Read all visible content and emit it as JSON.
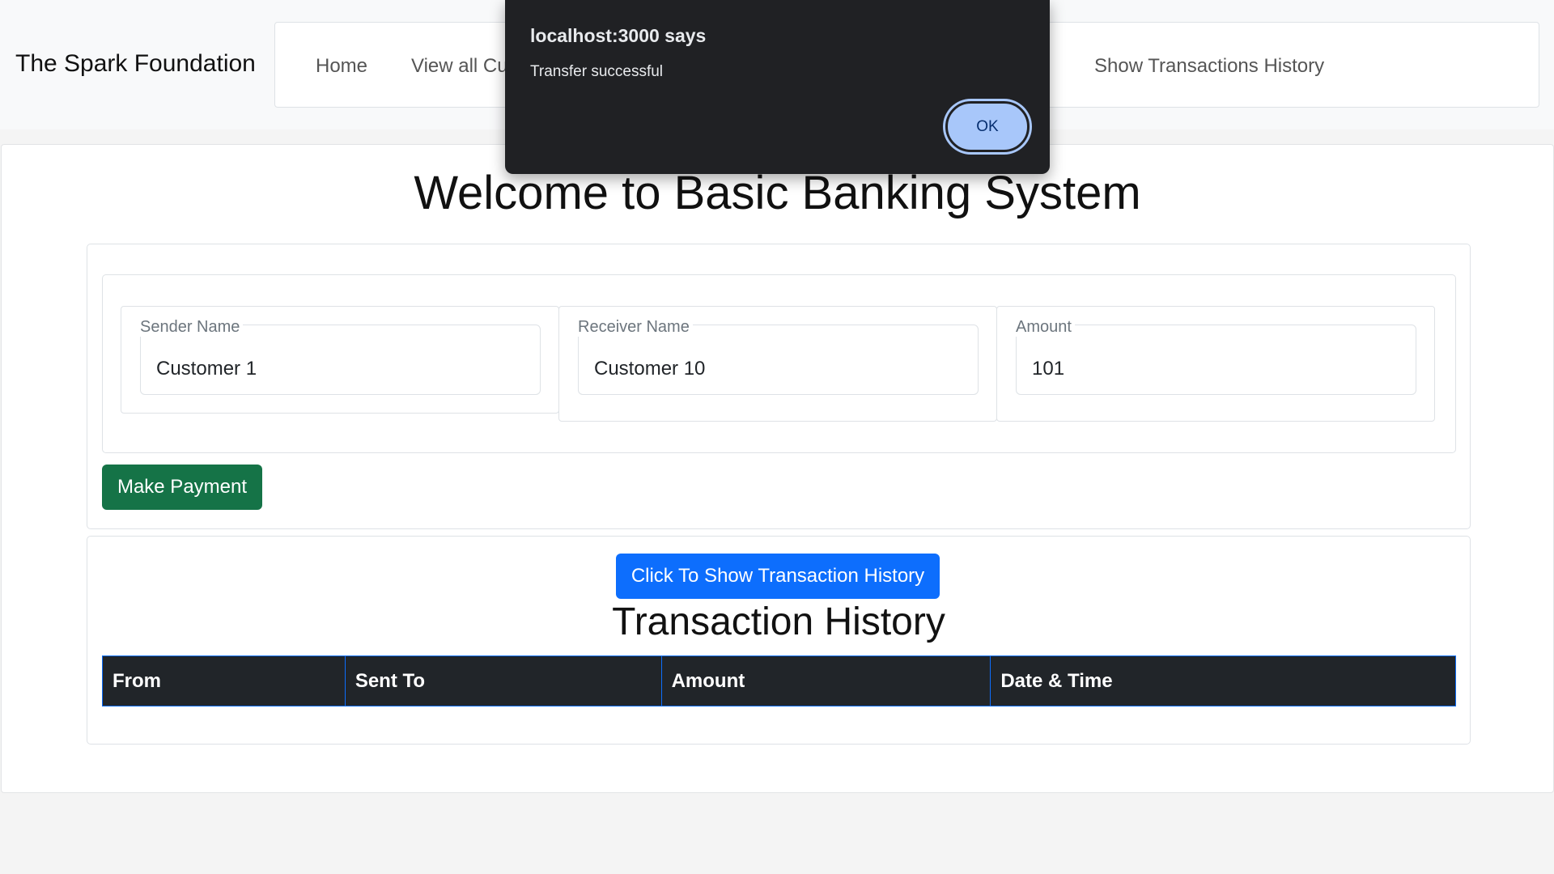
{
  "navbar": {
    "brand": "The Spark Foundation",
    "links": [
      {
        "label": "Home"
      },
      {
        "label": "View all Cu"
      },
      {
        "label": "Show Transactions History"
      }
    ]
  },
  "main": {
    "title": "Welcome to Basic Banking System"
  },
  "form": {
    "sender": {
      "label": "Sender Name",
      "value": "Customer 1"
    },
    "receiver": {
      "label": "Receiver Name",
      "value": "Customer 10"
    },
    "amount": {
      "label": "Amount",
      "value": "101"
    },
    "submit_label": "Make Payment"
  },
  "history": {
    "button_label": "Click To Show Transaction History",
    "title": "Transaction History",
    "columns": [
      "From",
      "Sent To",
      "Amount",
      "Date & Time"
    ],
    "rows": []
  },
  "dialog": {
    "origin": "localhost:3000 says",
    "message": "Transfer successful",
    "ok_label": "OK"
  },
  "colors": {
    "primary": "#0d6efd",
    "success": "#157347",
    "dark": "#212529",
    "dialog_bg": "#202124",
    "dialog_button": "#a8c7fa"
  }
}
